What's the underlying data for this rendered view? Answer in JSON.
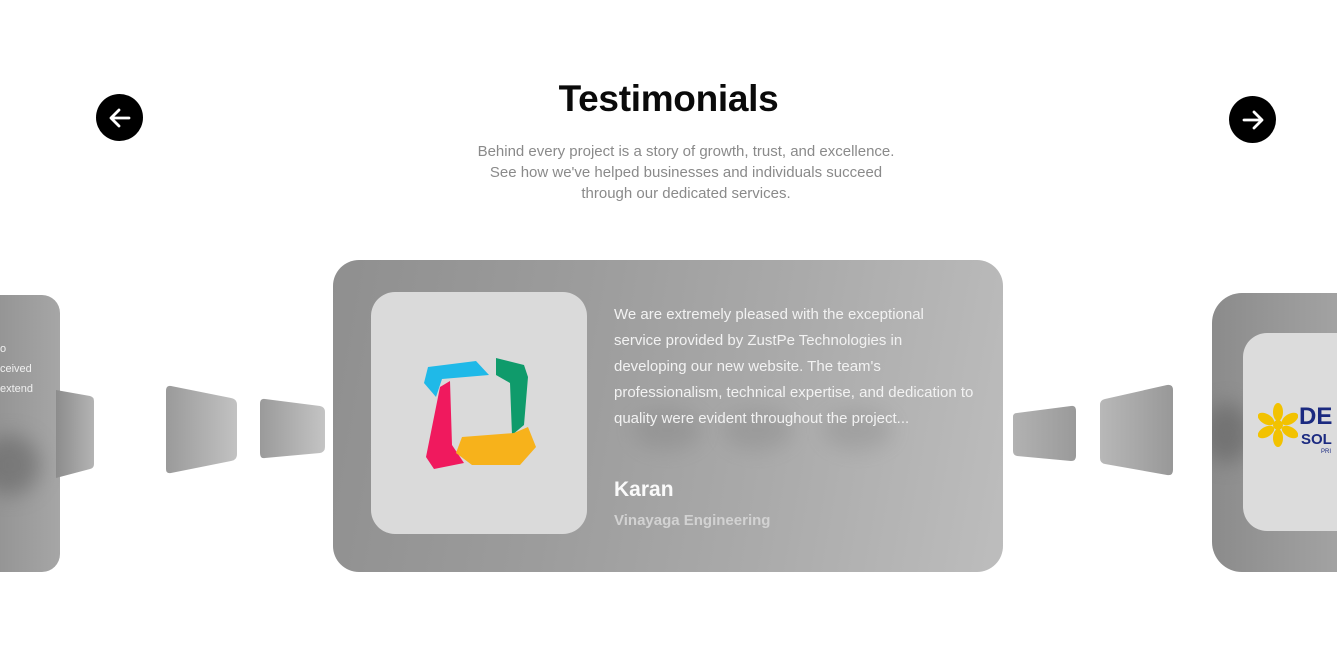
{
  "section": {
    "title": "Testimonials",
    "subtitle_lines": [
      "Behind every project is a story of growth, trust, and excellence.",
      "See how we've helped businesses and individuals succeed",
      "through our dedicated services."
    ]
  },
  "nav": {
    "prev_icon": "arrow-left-icon",
    "next_icon": "arrow-right-icon"
  },
  "active_testimonial": {
    "quote": "We are extremely pleased with the exceptional service provided by ZustPe Technologies in developing our new website. The team's professionalism, technical expertise, and dedication to quality were evident throughout the project...",
    "author": "Karan",
    "company": "Vinayaga Engineering",
    "logo_icon": "vinayaga-logo-icon"
  },
  "previous_testimonial_fragments": [
    "o",
    "ceived",
    "extend"
  ],
  "next_testimonial": {
    "logo_text_top": "DE",
    "logo_text_mid": "SOL",
    "logo_text_small": "PRI",
    "logo_icon": "flower-logo-icon"
  },
  "colors": {
    "accent_cyan": "#1fb9e8",
    "accent_green": "#0f9b6b",
    "accent_pink": "#f0195e",
    "accent_yellow": "#f7b21b",
    "logo_navy": "#1b2a80",
    "logo_gold": "#f2c200"
  }
}
